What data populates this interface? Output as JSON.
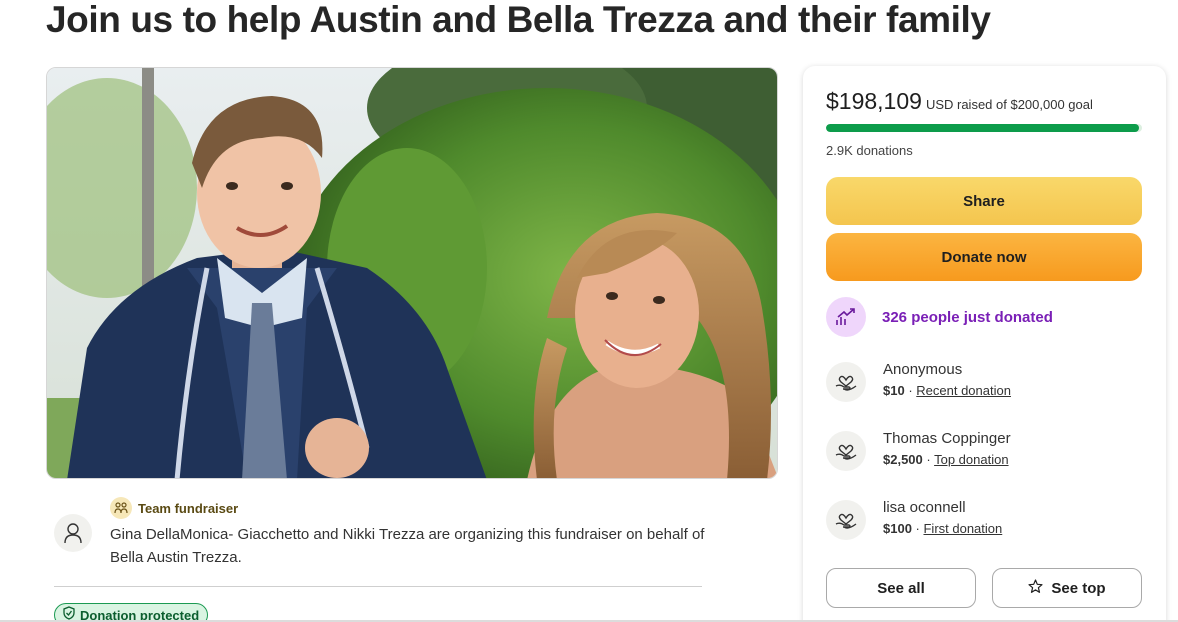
{
  "page": {
    "title": "Join us to help Austin and Bella Trezza and their family"
  },
  "organizer": {
    "team_label": "Team fundraiser",
    "team_icon": "team-icon",
    "avatar_icon": "user-icon",
    "text": "Gina DellaMonica- Giacchetto and Nikki Trezza are organizing this fundraiser on behalf of Bella Austin Trezza."
  },
  "badge": {
    "protected_label": "Donation protected",
    "icon": "shield-icon"
  },
  "donation_card": {
    "raised_amount": "$198,109",
    "raised_text": "USD raised of $200,000 goal",
    "progress_fraction": 0.99,
    "donations_count": "2.9K donations",
    "share_label": "Share",
    "donate_label": "Donate now",
    "trend_text": "326 people just donated",
    "trend_icon": "trending-up-icon",
    "donors": [
      {
        "name": "Anonymous",
        "amount": "$10",
        "tag": "Recent donation",
        "icon": "heart-hand-icon"
      },
      {
        "name": "Thomas Coppinger",
        "amount": "$2,500",
        "tag": "Top donation",
        "icon": "heart-hand-icon"
      },
      {
        "name": "lisa oconnell",
        "amount": "$100",
        "tag": "First donation",
        "icon": "heart-hand-icon"
      }
    ],
    "separator": " · ",
    "see_all_label": "See all",
    "see_top_label": "See top",
    "see_top_icon": "star-icon"
  },
  "colors": {
    "progress": "#0d9c4b",
    "share_button": "#f6cd5c",
    "donate_button": "#f9a62c",
    "trend_text": "#7a1fb6",
    "badge_green": "#1b9a52"
  }
}
